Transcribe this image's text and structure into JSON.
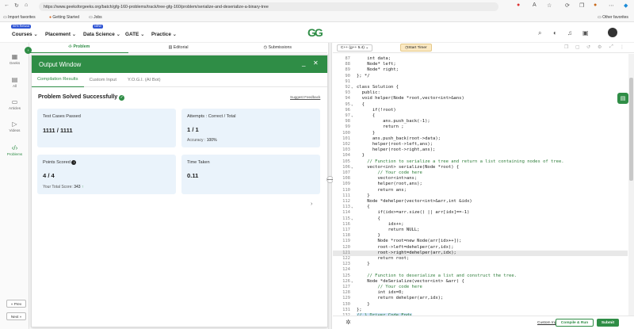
{
  "browser": {
    "url": "https://www.geeksforgeeks.org/batch/gfg-160-problems/track/tree-gfg-160/problem/serialize-and-deserialize-a-binary-tree",
    "bookmarks": [
      "Import favorites",
      "Getting Started",
      "Jobs"
    ],
    "other_favorites": "Other favorites"
  },
  "nav": {
    "courses": "Courses",
    "courses_badge": "90% Refund",
    "placement": "Placement",
    "data_science": "Data Science",
    "data_science_badge": "NEW",
    "gate": "GATE",
    "practice": "Practice",
    "logo": "GG"
  },
  "sidebar": {
    "items": [
      {
        "label": "Geeks",
        "icon": "dashboard-icon"
      },
      {
        "label": "All",
        "icon": "grid-icon"
      },
      {
        "label": "Articles",
        "icon": "articles-icon"
      },
      {
        "label": "Videos",
        "icon": "video-icon"
      },
      {
        "label": "Problems",
        "icon": "code-icon"
      }
    ],
    "prev": "« Prev",
    "next": "Next »"
  },
  "problem_tabs": [
    "Problem",
    "Editorial",
    "Submissions"
  ],
  "output": {
    "title": "Output Window",
    "tabs": [
      "Compilation Results",
      "Custom Input",
      "Y.O.G.I. (AI Bot)"
    ],
    "status": "Problem Solved Successfully",
    "suggest": "Suggest Feedback",
    "tests_label": "Test Cases Passed",
    "tests_value": "1111 / 1111",
    "attempts_label": "Attempts : Correct / Total",
    "attempts_value": "1 / 1",
    "accuracy_label": "Accuracy :",
    "accuracy_value": "100%",
    "points_label": "Points Scored",
    "points_value": "4 / 4",
    "total_label": "Your Total Score:",
    "total_value": "343",
    "time_label": "Time Taken",
    "time_value": "0.11"
  },
  "editor": {
    "lang": "C++ (g++ 5.4)",
    "timer": "Start Timer",
    "lines": [
      {
        "n": "87",
        "t": "    int data;"
      },
      {
        "n": "88",
        "t": "    Node* left;"
      },
      {
        "n": "89",
        "t": "    Node* right;"
      },
      {
        "n": "90",
        "t": "}; */"
      },
      {
        "n": "91",
        "t": ""
      },
      {
        "n": "92",
        "t": "class Solution {",
        "f": true
      },
      {
        "n": "93",
        "t": "  public:"
      },
      {
        "n": "94",
        "t": "  void helper(Node *root,vector<int>&ans)"
      },
      {
        "n": "95",
        "t": "  {",
        "f": true
      },
      {
        "n": "96",
        "t": "      if(!root)"
      },
      {
        "n": "97",
        "t": "      {",
        "f": true
      },
      {
        "n": "98",
        "t": "          ans.push_back(-1);"
      },
      {
        "n": "99",
        "t": "          return ;"
      },
      {
        "n": "100",
        "t": "      }"
      },
      {
        "n": "101",
        "t": "      ans.push_back(root->data);"
      },
      {
        "n": "102",
        "t": "      helper(root->left,ans);"
      },
      {
        "n": "103",
        "t": "      helper(root->right,ans);"
      },
      {
        "n": "104",
        "t": "  }"
      },
      {
        "n": "105",
        "t": "    // Function to serialize a tree and return a list containing nodes of tree."
      },
      {
        "n": "106",
        "t": "    vector<int> serialize(Node *root) {",
        "f": true
      },
      {
        "n": "107",
        "t": "        // Your code here"
      },
      {
        "n": "108",
        "t": "        vector<int>ans;"
      },
      {
        "n": "109",
        "t": "        helper(root,ans);"
      },
      {
        "n": "110",
        "t": "        return ans;"
      },
      {
        "n": "111",
        "t": "    }"
      },
      {
        "n": "112",
        "t": "    Node *dehelper(vector<int>&arr,int &idx)"
      },
      {
        "n": "113",
        "t": "    {",
        "f": true
      },
      {
        "n": "114",
        "t": "        if(idx>=arr.size() || arr[idx]==-1)"
      },
      {
        "n": "115",
        "t": "        {",
        "f": true
      },
      {
        "n": "116",
        "t": "            idx++;"
      },
      {
        "n": "117",
        "t": "            return NULL;"
      },
      {
        "n": "118",
        "t": "        }"
      },
      {
        "n": "119",
        "t": "        Node *root=new Node(arr[idx++]);"
      },
      {
        "n": "120",
        "t": "        root->left=dehelper(arr,idx);"
      },
      {
        "n": "121",
        "t": "        root->right=dehelper(arr,idx);",
        "h": true
      },
      {
        "n": "122",
        "t": "        return root;"
      },
      {
        "n": "123",
        "t": "    }"
      },
      {
        "n": "124",
        "t": ""
      },
      {
        "n": "125",
        "t": "    // Function to deserialize a list and construct the tree."
      },
      {
        "n": "126",
        "t": "    Node *deSerialize(vector<int> &arr) {",
        "f": true
      },
      {
        "n": "127",
        "t": "        // Your code here"
      },
      {
        "n": "128",
        "t": "        int idx=0;"
      },
      {
        "n": "129",
        "t": "        return dehelper(arr,idx);"
      },
      {
        "n": "130",
        "t": "    }"
      },
      {
        "n": "131",
        "t": "};"
      },
      {
        "n": "132",
        "t": "// } Driver Code Ends"
      }
    ],
    "custom_input": "Custom Input",
    "compile": "Compile & Run",
    "submit": "Submit"
  },
  "colors": {
    "brand": "#2f8d46",
    "card": "#eaf3fb"
  }
}
